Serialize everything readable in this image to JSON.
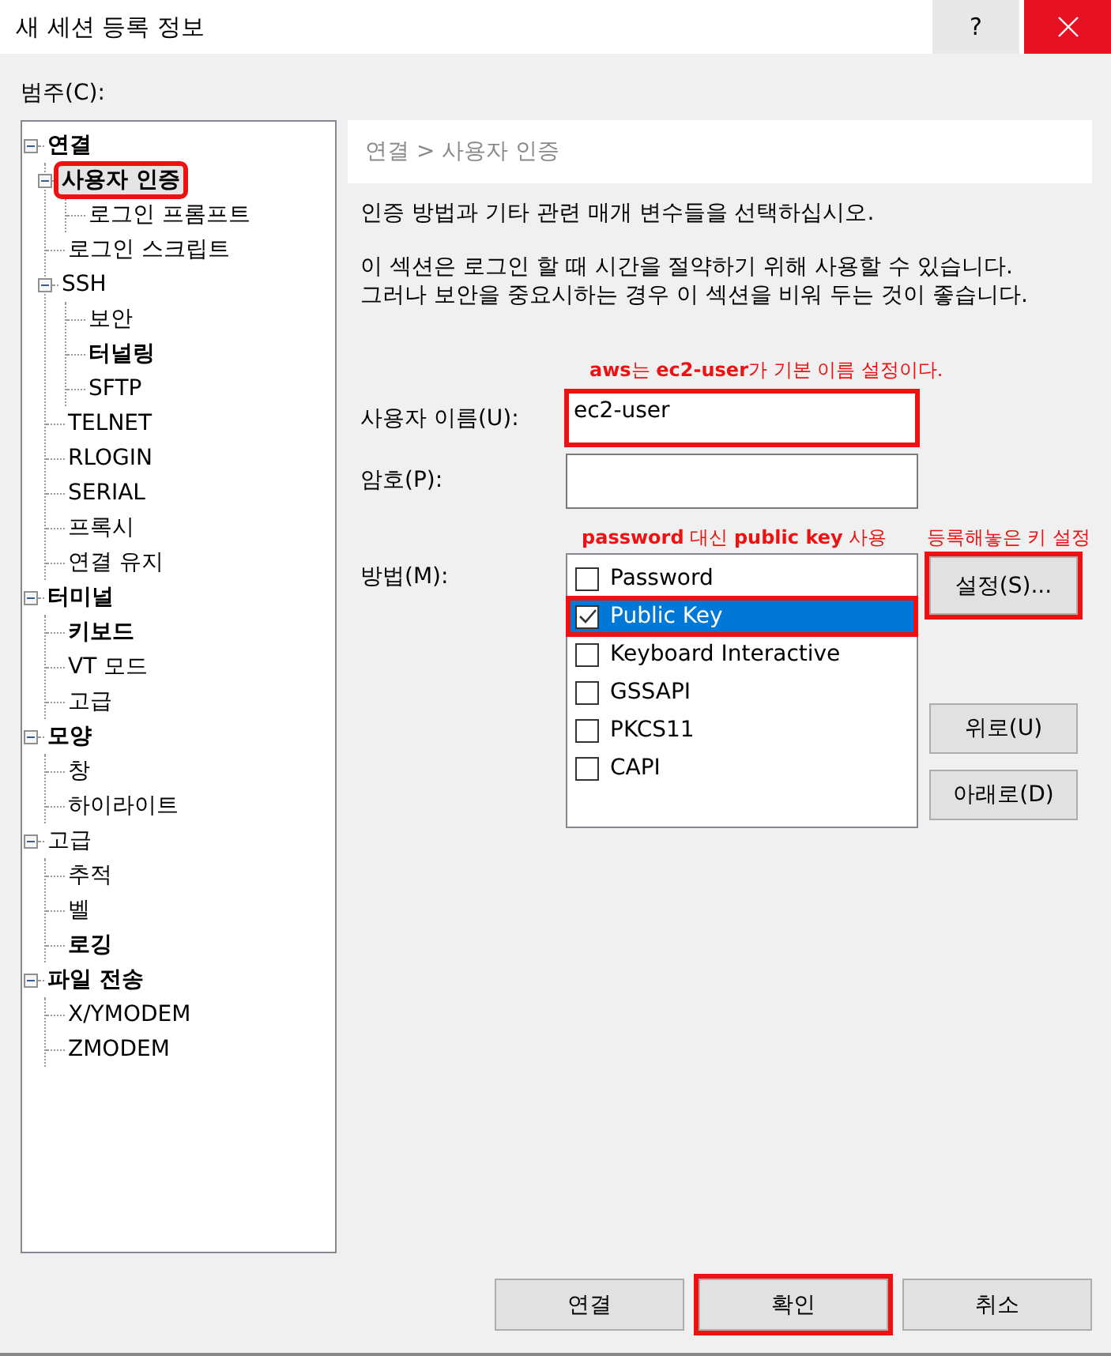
{
  "window": {
    "title": "새 세션 등록 정보",
    "help_button": "?"
  },
  "category_label": "범주(C):",
  "tree": [
    {
      "label": "연결",
      "bold": true,
      "expanded": true,
      "selected": false,
      "highlighted": false,
      "children": [
        {
          "label": "사용자 인증",
          "bold": true,
          "expanded": true,
          "selected": true,
          "highlighted": true,
          "children": [
            {
              "label": "로그인 프롬프트",
              "bold": false,
              "selected": false,
              "highlighted": false
            }
          ]
        },
        {
          "label": "로그인 스크립트",
          "bold": false,
          "selected": false,
          "highlighted": false
        },
        {
          "label": "SSH",
          "bold": false,
          "expanded": true,
          "selected": false,
          "highlighted": false,
          "children": [
            {
              "label": "보안",
              "bold": false,
              "selected": false,
              "highlighted": false
            },
            {
              "label": "터널링",
              "bold": true,
              "selected": false,
              "highlighted": false
            },
            {
              "label": "SFTP",
              "bold": false,
              "selected": false,
              "highlighted": false
            }
          ]
        },
        {
          "label": "TELNET",
          "bold": false,
          "selected": false,
          "highlighted": false
        },
        {
          "label": "RLOGIN",
          "bold": false,
          "selected": false,
          "highlighted": false
        },
        {
          "label": "SERIAL",
          "bold": false,
          "selected": false,
          "highlighted": false
        },
        {
          "label": "프록시",
          "bold": false,
          "selected": false,
          "highlighted": false
        },
        {
          "label": "연결 유지",
          "bold": false,
          "selected": false,
          "highlighted": false
        }
      ]
    },
    {
      "label": "터미널",
      "bold": true,
      "expanded": true,
      "selected": false,
      "highlighted": false,
      "children": [
        {
          "label": "키보드",
          "bold": true,
          "selected": false,
          "highlighted": false
        },
        {
          "label": "VT 모드",
          "bold": false,
          "selected": false,
          "highlighted": false
        },
        {
          "label": "고급",
          "bold": false,
          "selected": false,
          "highlighted": false
        }
      ]
    },
    {
      "label": "모양",
      "bold": true,
      "expanded": true,
      "selected": false,
      "highlighted": false,
      "children": [
        {
          "label": "창",
          "bold": false,
          "selected": false,
          "highlighted": false
        },
        {
          "label": "하이라이트",
          "bold": false,
          "selected": false,
          "highlighted": false
        }
      ]
    },
    {
      "label": "고급",
      "bold": false,
      "expanded": true,
      "selected": false,
      "highlighted": false,
      "children": [
        {
          "label": "추적",
          "bold": false,
          "selected": false,
          "highlighted": false
        },
        {
          "label": "벨",
          "bold": false,
          "selected": false,
          "highlighted": false
        },
        {
          "label": "로깅",
          "bold": true,
          "selected": false,
          "highlighted": false
        }
      ]
    },
    {
      "label": "파일 전송",
      "bold": true,
      "expanded": true,
      "selected": false,
      "highlighted": false,
      "children": [
        {
          "label": "X/YMODEM",
          "bold": false,
          "selected": false,
          "highlighted": false
        },
        {
          "label": "ZMODEM",
          "bold": false,
          "selected": false,
          "highlighted": false
        }
      ]
    }
  ],
  "breadcrumb": "연결 > 사용자 인증",
  "description": [
    "인증 방법과 기타 관련 매개 변수들을 선택하십시오.",
    "이 섹션은 로그인 할 때 시간을 절약하기 위해 사용할 수 있습니다. 그러나 보안을 중요시하는 경우 이 섹션을 비워 두는 것이 좋습니다."
  ],
  "username": {
    "note": "**aws**는 **ec2-user**가 기본 이름 설정이다.",
    "label": "사용자 이름(U):",
    "value": "ec2-user",
    "highlighted": true
  },
  "password": {
    "label": "암호(P):"
  },
  "method": {
    "label": "방법(M):",
    "note": "**password** 대신 **public key** 사용",
    "items": [
      {
        "label": "Password",
        "checked": false,
        "selected": false,
        "highlighted": false
      },
      {
        "label": "Public Key",
        "checked": true,
        "selected": true,
        "highlighted": true
      },
      {
        "label": "Keyboard Interactive",
        "checked": false,
        "selected": false,
        "highlighted": false
      },
      {
        "label": "GSSAPI",
        "checked": false,
        "selected": false,
        "highlighted": false
      },
      {
        "label": "PKCS11",
        "checked": false,
        "selected": false,
        "highlighted": false
      },
      {
        "label": "CAPI",
        "checked": false,
        "selected": false,
        "highlighted": false
      }
    ]
  },
  "side_buttons": [
    {
      "label": "설정(S)...",
      "highlighted": true,
      "note": "등록해놓은 키 설정"
    },
    {
      "label": "위로(U)",
      "highlighted": false
    },
    {
      "label": "아래로(D)",
      "highlighted": false
    }
  ],
  "buttons": [
    {
      "label": "연결",
      "highlighted": false
    },
    {
      "label": "확인",
      "highlighted": true
    },
    {
      "label": "취소",
      "highlighted": false
    }
  ]
}
